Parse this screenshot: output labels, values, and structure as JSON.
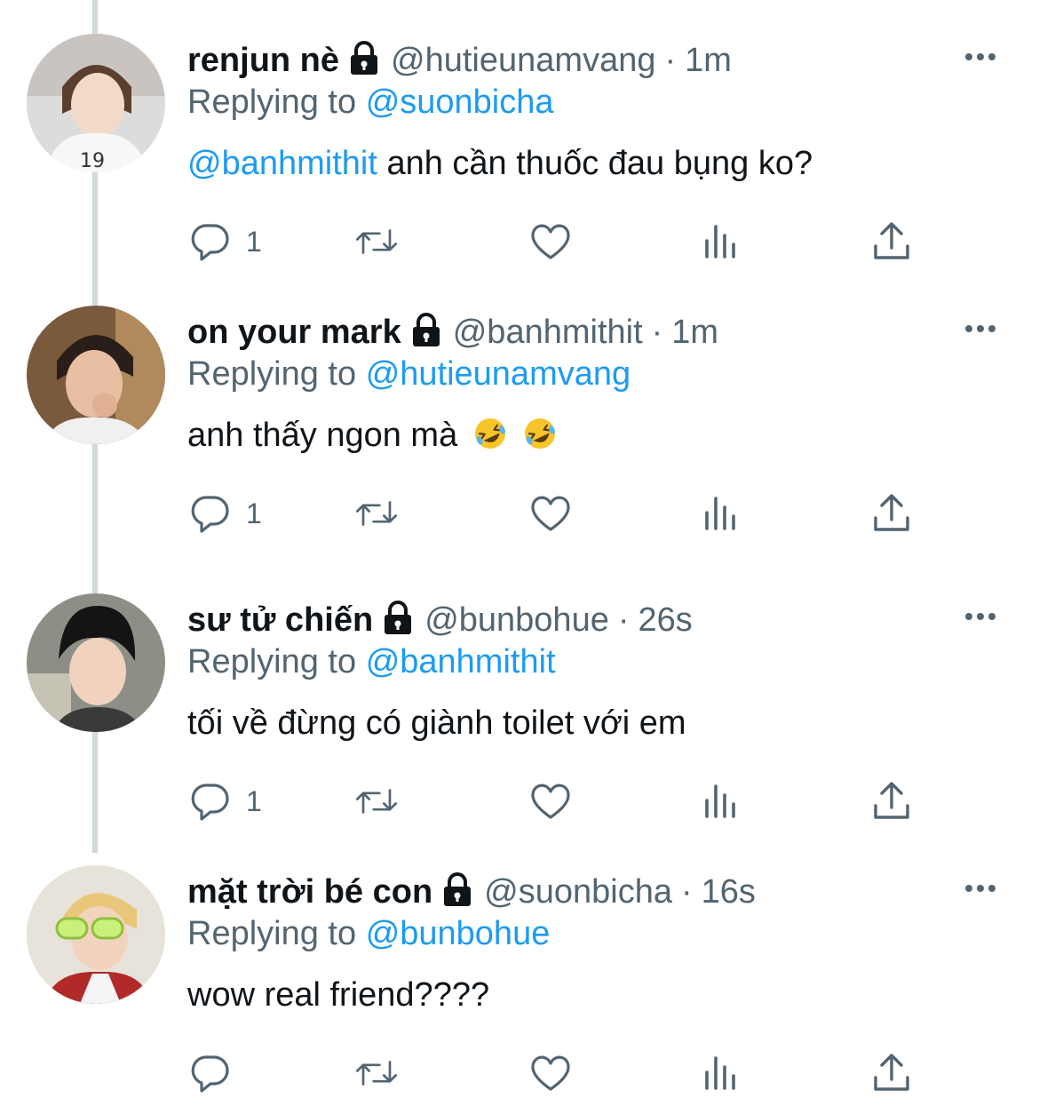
{
  "tweets": [
    {
      "display_name": "renjun nè",
      "handle": "@hutieunamvang",
      "separator": "·",
      "time": "1m",
      "replying_prefix": "Replying to",
      "replying_to": "@suonbicha",
      "mention": "@banhmithit",
      "text": "anh cần thuốc đau bụng ko?",
      "reply_count": "1"
    },
    {
      "display_name": "on your mark",
      "handle": "@banhmithit",
      "separator": "·",
      "time": "1m",
      "replying_prefix": "Replying to",
      "replying_to": "@hutieunamvang",
      "mention": "",
      "text": "anh thấy ngon mà",
      "reply_count": "1"
    },
    {
      "display_name": "sư tử chiến",
      "handle": "@bunbohue",
      "separator": "·",
      "time": "26s",
      "replying_prefix": "Replying to",
      "replying_to": "@banhmithit",
      "mention": "",
      "text": "tối về đừng có giành toilet với em",
      "reply_count": "1"
    },
    {
      "display_name": "mặt trời bé con",
      "handle": "@suonbicha",
      "separator": "·",
      "time": "16s",
      "replying_prefix": "Replying to",
      "replying_to": "@bunbohue",
      "mention": "",
      "text": "wow real friend????",
      "reply_count": ""
    }
  ],
  "icons": {
    "lock": "lock-icon",
    "more": "more-icon",
    "reply": "reply-icon",
    "retweet": "retweet-icon",
    "like": "heart-icon",
    "views": "views-icon",
    "share": "share-icon",
    "emoji": "rolling-on-floor-laughing-emoji"
  },
  "colors": {
    "link": "#1d9bf0",
    "secondary_text": "#536471",
    "primary_text": "#0f1419",
    "thread_line": "#cfd9de"
  }
}
